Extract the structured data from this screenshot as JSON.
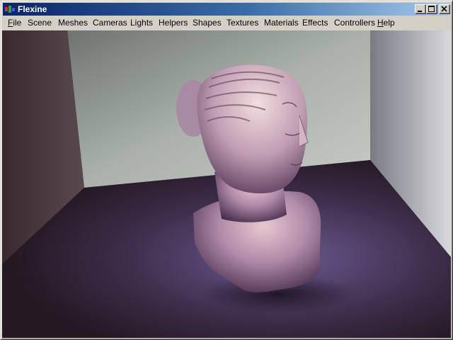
{
  "window": {
    "title": "Flexine",
    "controls": {
      "minimize_icon": "minimize-icon",
      "maximize_icon": "maximize-icon",
      "close_icon": "close-icon"
    }
  },
  "menu": {
    "items": [
      {
        "accel": "F",
        "rest": "ile"
      },
      {
        "accel": "",
        "rest": "Scene"
      },
      {
        "accel": "",
        "rest": "Meshes"
      },
      {
        "accel": "",
        "rest": "Cameras"
      },
      {
        "accel": "",
        "rest": "Lights"
      },
      {
        "accel": "",
        "rest": "Helpers"
      },
      {
        "accel": "",
        "rest": "Shapes"
      },
      {
        "accel": "",
        "rest": "Textures"
      },
      {
        "accel": "",
        "rest": "Materials"
      },
      {
        "accel": "",
        "rest": "Effects"
      },
      {
        "accel": "",
        "rest": "Controllers"
      },
      {
        "accel": "H",
        "rest": "elp"
      }
    ]
  },
  "viewport": {
    "content": "3D render of a classical female bust in a room corner lit by purple-blue light"
  },
  "colors": {
    "title_gradient_start": "#0a246a",
    "title_gradient_end": "#a6caf0",
    "chrome": "#d4d0c8",
    "floor": "#3a2a44",
    "back_wall": "#a8b0a8"
  }
}
